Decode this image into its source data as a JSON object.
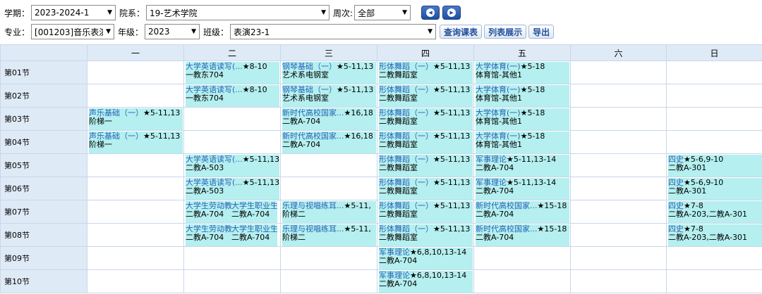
{
  "filters": {
    "row1": {
      "term_label": "学期：",
      "term_value": "2023-2024-1",
      "dept_label": "院系：",
      "dept_value": "19-艺术学院",
      "week_label": "周次:",
      "week_value": "全部"
    },
    "row2": {
      "major_label": "专业：",
      "major_value": "[001203]音乐表演",
      "grade_label": "年级：",
      "grade_value": "2023",
      "class_label": "班级：",
      "class_value": "表演23-1",
      "query_label": "查询课表",
      "list_label": "列表展示",
      "export_label": "导出"
    }
  },
  "table": {
    "days": [
      "一",
      "二",
      "三",
      "四",
      "五",
      "六",
      "日"
    ],
    "periods": [
      "第01节",
      "第02节",
      "第03节",
      "第04节",
      "第05节",
      "第06节",
      "第07节",
      "第08节",
      "第09节",
      "第10节"
    ],
    "cells": [
      [
        [],
        [
          {
            "name": "大学英语读写(...",
            "weeks": "★8-10",
            "room": "一教东704"
          }
        ],
        [
          {
            "name": "钢琴基础（一）",
            "weeks": "★5-11,13",
            "room": "艺术系电钢室"
          }
        ],
        [
          {
            "name": "形体舞蹈（一）",
            "weeks": "★5-11,13",
            "room": "二教舞蹈室"
          }
        ],
        [
          {
            "name": "大学体育(一)",
            "weeks": "★5-18",
            "room": "体育馆-其他1"
          }
        ],
        [],
        []
      ],
      [
        [],
        [
          {
            "name": "大学英语读写(...",
            "weeks": "★8-10",
            "room": "一教东704"
          }
        ],
        [
          {
            "name": "钢琴基础（一）",
            "weeks": "★5-11,13",
            "room": "艺术系电钢室"
          }
        ],
        [
          {
            "name": "形体舞蹈（一）",
            "weeks": "★5-11,13",
            "room": "二教舞蹈室"
          }
        ],
        [
          {
            "name": "大学体育(一)",
            "weeks": "★5-18",
            "room": "体育馆-其他1"
          }
        ],
        [],
        []
      ],
      [
        [
          {
            "name": "声乐基础（一）",
            "weeks": "★5-11,13",
            "room": "阶梯一"
          }
        ],
        [],
        [
          {
            "name": "新时代高校国家...",
            "weeks": "★16,18",
            "room": "二教A-704"
          }
        ],
        [
          {
            "name": "形体舞蹈（一）",
            "weeks": "★5-11,13",
            "room": "二教舞蹈室"
          }
        ],
        [
          {
            "name": "大学体育(一)",
            "weeks": "★5-18",
            "room": "体育馆-其他1"
          }
        ],
        [],
        []
      ],
      [
        [
          {
            "name": "声乐基础（一）",
            "weeks": "★5-11,13",
            "room": "阶梯一"
          }
        ],
        [],
        [
          {
            "name": "新时代高校国家...",
            "weeks": "★16,18",
            "room": "二教A-704"
          }
        ],
        [
          {
            "name": "形体舞蹈（一）",
            "weeks": "★5-11,13",
            "room": "二教舞蹈室"
          }
        ],
        [
          {
            "name": "大学体育(一)",
            "weeks": "★5-18",
            "room": "体育馆-其他1"
          }
        ],
        [],
        []
      ],
      [
        [],
        [
          {
            "name": "大学英语读写(...",
            "weeks": "★5-11,13",
            "room": "二教A-503"
          }
        ],
        [],
        [
          {
            "name": "形体舞蹈（一）",
            "weeks": "★5-11,13",
            "room": "二教舞蹈室"
          }
        ],
        [
          {
            "name": "军事理论",
            "weeks": "★5-11,13-14",
            "room": "二教A-704"
          }
        ],
        [],
        [
          {
            "name": "四史",
            "weeks": "★5-6,9-10",
            "room": "二教A-301"
          }
        ]
      ],
      [
        [],
        [
          {
            "name": "大学英语读写(...",
            "weeks": "★5-11,13",
            "room": "二教A-503"
          }
        ],
        [],
        [
          {
            "name": "形体舞蹈（一）",
            "weeks": "★5-11,13",
            "room": "二教舞蹈室"
          }
        ],
        [
          {
            "name": "军事理论",
            "weeks": "★5-11,13-14",
            "room": "二教A-704"
          }
        ],
        [],
        [
          {
            "name": "四史",
            "weeks": "★5-6,9-10",
            "room": "二教A-301"
          }
        ]
      ],
      [
        [],
        [
          {
            "name": "大学生劳动教育",
            "weeks": "",
            "room": "二教A-704"
          },
          {
            "name": "大学生职业生涯",
            "weeks": "",
            "room": "二教A-704"
          }
        ],
        [
          {
            "name": "乐理与视唱练耳...",
            "weeks": "★5-11,",
            "room": "阶梯二"
          }
        ],
        [
          {
            "name": "形体舞蹈（一）",
            "weeks": "★5-11,13",
            "room": "二教舞蹈室"
          }
        ],
        [
          {
            "name": "新时代高校国家...",
            "weeks": "★15-18",
            "room": "二教A-704"
          }
        ],
        [],
        [
          {
            "name": "四史",
            "weeks": "★7-8",
            "room": "二教A-203,二教A-301"
          }
        ]
      ],
      [
        [],
        [
          {
            "name": "大学生劳动教育",
            "weeks": "",
            "room": "二教A-704"
          },
          {
            "name": "大学生职业生涯",
            "weeks": "",
            "room": "二教A-704"
          }
        ],
        [
          {
            "name": "乐理与视唱练耳...",
            "weeks": "★5-11,",
            "room": "阶梯二"
          }
        ],
        [
          {
            "name": "形体舞蹈（一）",
            "weeks": "★5-11,13",
            "room": "二教舞蹈室"
          }
        ],
        [
          {
            "name": "新时代高校国家...",
            "weeks": "★15-18",
            "room": "二教A-704"
          }
        ],
        [],
        [
          {
            "name": "四史",
            "weeks": "★7-8",
            "room": "二教A-203,二教A-301"
          }
        ]
      ],
      [
        [],
        [],
        [],
        [
          {
            "name": "军事理论",
            "weeks": "★6,8,10,13-14",
            "room": "二教A-704"
          }
        ],
        [],
        [],
        []
      ],
      [
        [],
        [],
        [],
        [
          {
            "name": "军事理论",
            "weeks": "★6,8,10,13-14",
            "room": "二教A-704"
          }
        ],
        [],
        [],
        []
      ]
    ]
  }
}
